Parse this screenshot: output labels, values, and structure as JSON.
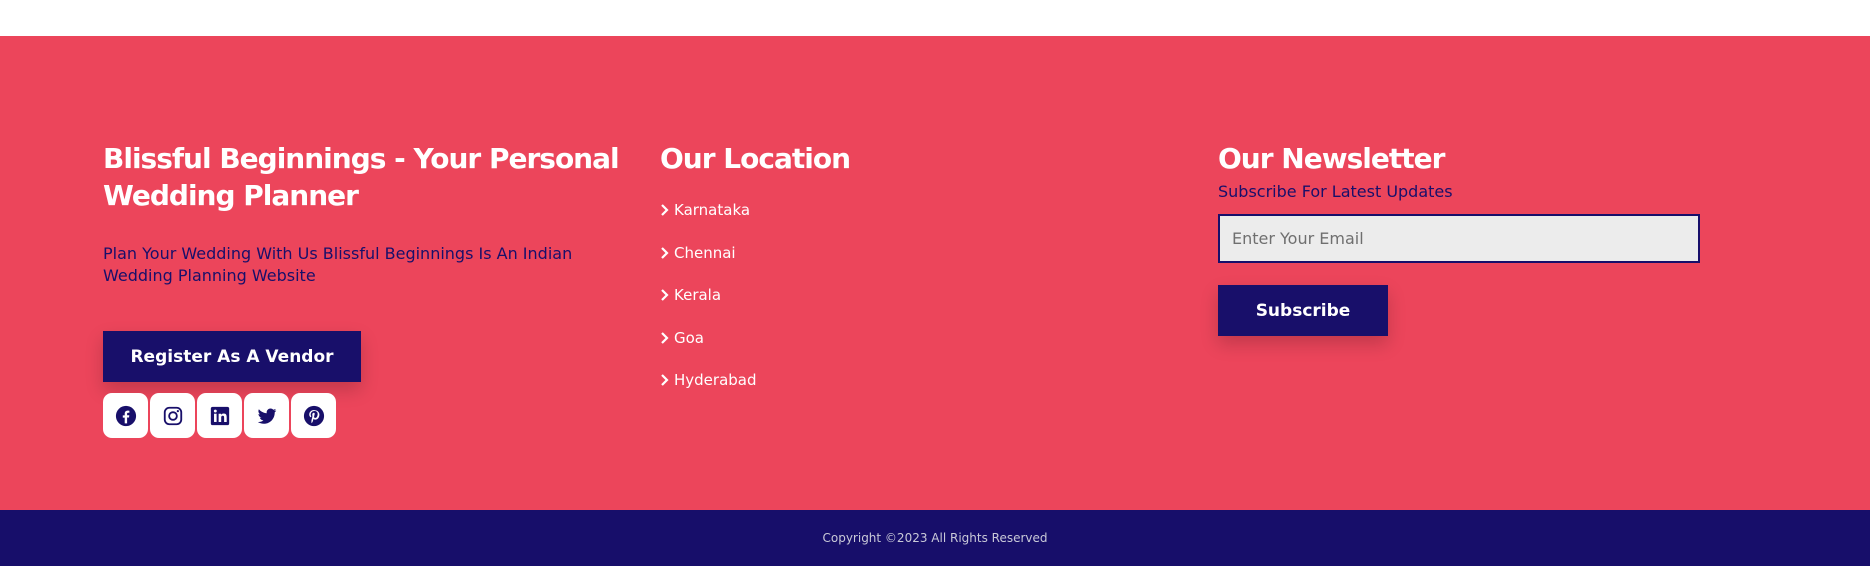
{
  "colors": {
    "footer_bg": "#ec455b",
    "navy": "#180f6a",
    "bottom_bar": "#170e6a",
    "white": "#ffffff"
  },
  "about": {
    "title": "Blissful Beginnings - Your Personal Wedding Planner",
    "description": "Plan Your Wedding With Us Blissful Beginnings Is An Indian Wedding Planning Website",
    "vendor_button": "Register As A Vendor",
    "socials": [
      {
        "icon": "facebook-icon"
      },
      {
        "icon": "instagram-icon"
      },
      {
        "icon": "linkedin-icon"
      },
      {
        "icon": "twitter-icon"
      },
      {
        "icon": "pinterest-icon"
      }
    ]
  },
  "location": {
    "title": "Our Location",
    "items": [
      {
        "label": "Karnataka",
        "icon": "chevron-right-icon"
      },
      {
        "label": "Chennai",
        "icon": "chevron-right-icon"
      },
      {
        "label": "Kerala",
        "icon": "chevron-right-icon"
      },
      {
        "label": "Goa",
        "icon": "chevron-right-icon"
      },
      {
        "label": "Hyderabad",
        "icon": "chevron-right-icon"
      }
    ]
  },
  "newsletter": {
    "title": "Our Newsletter",
    "subtitle": "Subscribe For Latest Updates",
    "email_value": "",
    "email_placeholder": "Enter Your Email",
    "subscribe_button": "Subscribe"
  },
  "footer": {
    "copyright": "Copyright ©2023 All Rights Reserved"
  }
}
